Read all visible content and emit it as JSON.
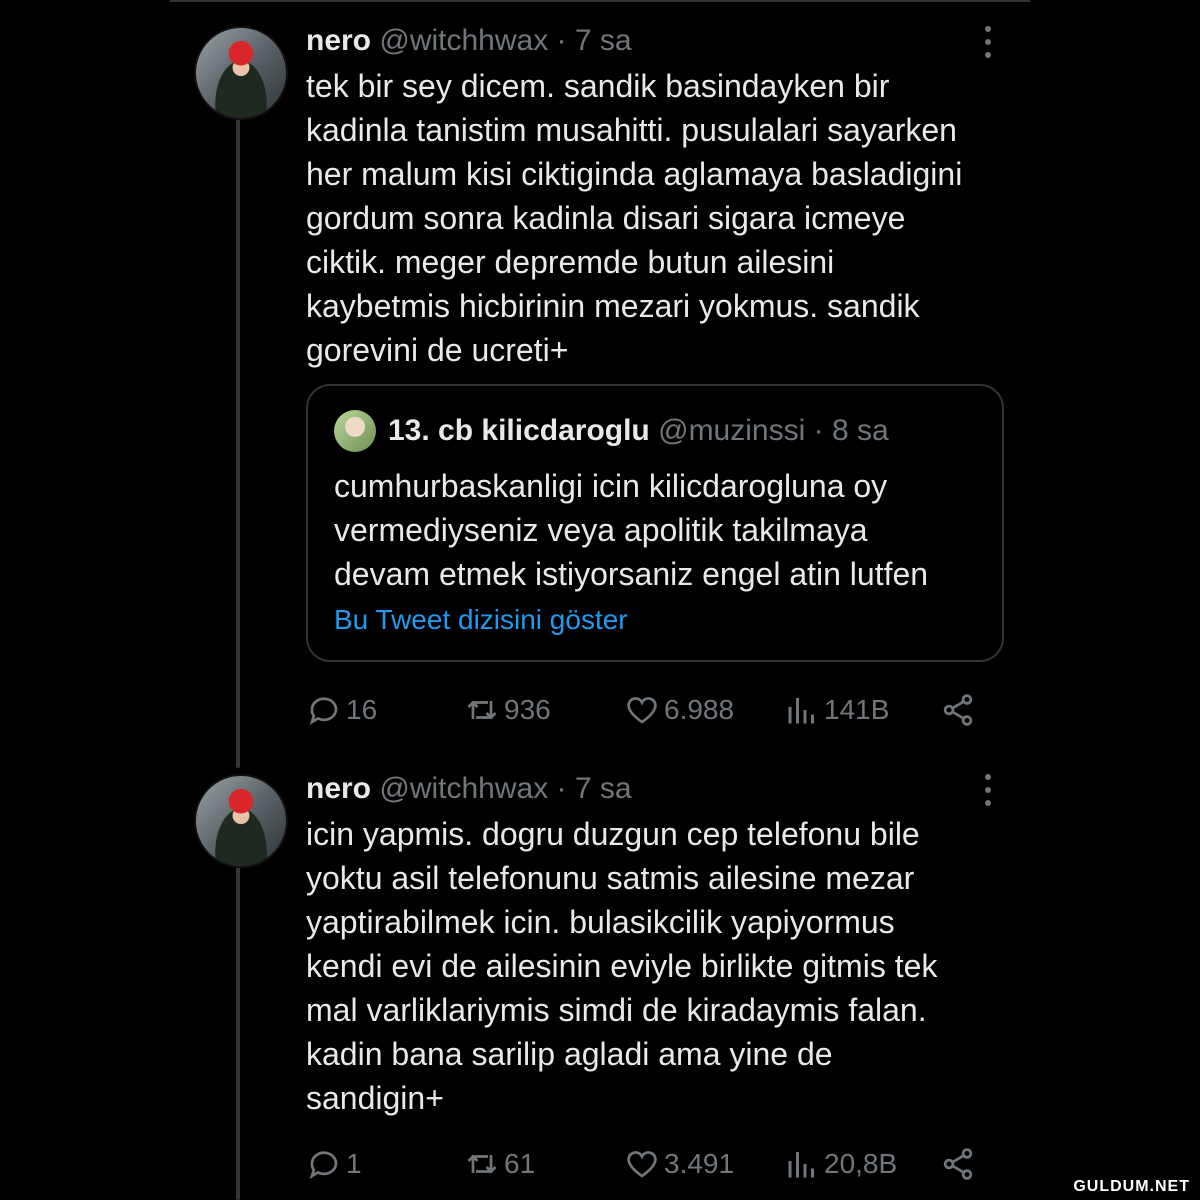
{
  "tweets": [
    {
      "name": "nero",
      "handle": "@witchhwax",
      "dot": "·",
      "time": "7 sa",
      "text": "tek bir sey dicem. sandik basindayken bir\nkadinla tanistim musahitti. pusulalari sayarken\nher malum kisi ciktiginda aglamaya basladigini\ngordum sonra kadinla disari sigara icmeye\nciktik. meger depremde butun ailesini\nkaybetmis hicbirinin mezari yokmus. sandik\ngorevini de ucreti+",
      "quote": {
        "name": "13. cb kilicdaroglu",
        "handle": "@muzinssi",
        "dot": "·",
        "time": "8 sa",
        "text": "cumhurbaskanligi icin kilicdarogluna oy\nvermediyseniz veya apolitik takilmaya\ndevam etmek istiyorsaniz engel atin lutfen",
        "link": "Bu Tweet dizisini göster"
      },
      "actions": {
        "replies": "16",
        "retweets": "936",
        "likes": "6.988",
        "views": "141B"
      }
    },
    {
      "name": "nero",
      "handle": "@witchhwax",
      "dot": "·",
      "time": "7 sa",
      "text": "icin yapmis. dogru duzgun cep telefonu bile\nyoktu asil telefonunu satmis ailesine mezar\nyaptirabilmek icin. bulasikcilik yapiyormus\nkendi evi de ailesinin eviyle birlikte gitmis tek\nmal varliklariymis simdi de kiradaymis falan.\nkadin bana sarilip agladi ama yine de\nsandigin+",
      "actions": {
        "replies": "1",
        "retweets": "61",
        "likes": "3.491",
        "views": "20,8B"
      }
    }
  ],
  "watermark": "GULDUM.NET",
  "colors": {
    "background": "#000000",
    "text": "#e7e9ea",
    "muted": "#71767b",
    "link": "#1d9bf0",
    "border": "#2f3336"
  }
}
